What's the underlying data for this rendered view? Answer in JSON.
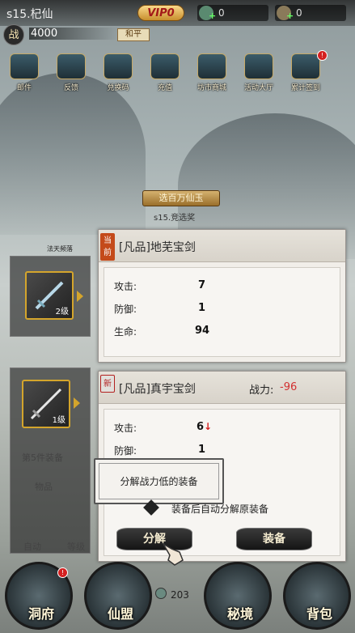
{
  "header": {
    "server_name": "s15.杞仙",
    "vip_label": "VIP0",
    "jade_value": "0",
    "gold_value": "0",
    "power_badge": "战",
    "power_value": "4000",
    "peace_mode": "和平"
  },
  "menu": [
    {
      "label": "邮件",
      "icon": "mail-icon"
    },
    {
      "label": "反馈",
      "icon": "feedback-icon"
    },
    {
      "label": "兑换码",
      "icon": "redeem-code-icon"
    },
    {
      "label": "充值",
      "icon": "recharge-icon"
    },
    {
      "label": "坊市商城",
      "icon": "market-icon"
    },
    {
      "label": "活动大厅",
      "icon": "event-hall-icon"
    },
    {
      "label": "累计签到",
      "icon": "signin-icon",
      "badge": "!"
    }
  ],
  "banner": {
    "title": "选百万仙玉",
    "subtitle": "s15.竞选奖"
  },
  "left_slots": {
    "label_top": "法天频落",
    "current_level": "2级",
    "new_level": "1级",
    "side_text_1": "第5件装备",
    "side_text_2": "物品",
    "auto_label": "自动",
    "grade_label": "等级"
  },
  "current_item": {
    "tag": "当前",
    "name": "[凡品]地芜宝剑",
    "stats": [
      {
        "label": "攻击:",
        "value": "7"
      },
      {
        "label": "防御:",
        "value": "1"
      },
      {
        "label": "生命:",
        "value": "94"
      }
    ]
  },
  "new_item": {
    "tag": "新",
    "name": "[凡品]真宇宝剑",
    "power_label": "战力:",
    "power_value": "-96",
    "stats": [
      {
        "label": "攻击:",
        "value": "6",
        "trend": "↓"
      },
      {
        "label": "防御:",
        "value": "1"
      }
    ]
  },
  "tooltip": {
    "text": "分解战力低的装备"
  },
  "auto_decompose_label": "装备后自动分解原装备",
  "buttons": {
    "decompose": "分解",
    "equip": "装备"
  },
  "bottom_nav": [
    {
      "label": "洞府",
      "badge": "!"
    },
    {
      "label": "仙盟"
    },
    {
      "label": "秘境"
    },
    {
      "label": "背包"
    }
  ],
  "center_currency": "203",
  "colors": {
    "accent_gold": "#d4a52c",
    "power_negative": "#d23030",
    "tag_current": "#c44a1a"
  }
}
